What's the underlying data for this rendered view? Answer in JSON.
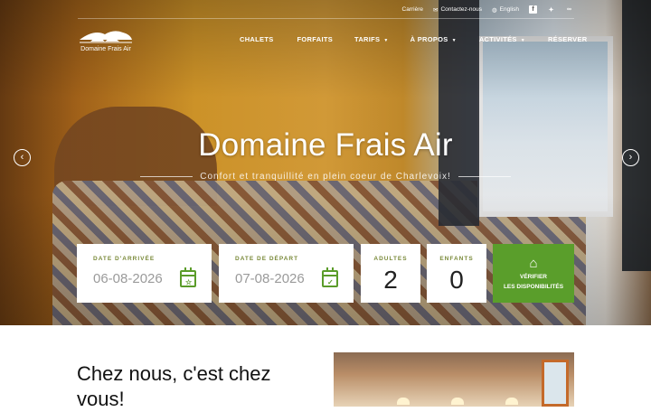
{
  "topbar": {
    "careers": "Carrière",
    "contact": "Contactez-nous",
    "language": "English"
  },
  "logo": {
    "text": "Domaine Frais Air"
  },
  "nav": [
    {
      "label": "CHALETS"
    },
    {
      "label": "FORFAITS"
    },
    {
      "label": "TARIFS"
    },
    {
      "label": "À PROPOS"
    },
    {
      "label": "ACTIVITÉS"
    },
    {
      "label": "RÉSERVER"
    }
  ],
  "hero": {
    "title": "Domaine Frais Air",
    "subtitle": "Confort et tranquillité en plein coeur de Charlevoix!"
  },
  "booking": {
    "arrival_label": "DATE D'ARRIVÉE",
    "arrival_value": "06-08-2026",
    "departure_label": "DATE DE DÉPART",
    "departure_value": "07-08-2026",
    "adults_label": "ADULTES",
    "adults_value": "2",
    "children_label": "ENFANTS",
    "children_value": "0",
    "cta_line1": "VÉRIFIER",
    "cta_line2": "LES DISPONIBILITÉS"
  },
  "intro": {
    "heading": "Chez nous, c'est chez vous!"
  },
  "colors": {
    "accent": "#5a9e2b",
    "label": "#7a8a3a"
  },
  "icons": [
    "envelope-icon",
    "globe-icon",
    "facebook-icon",
    "twitter-icon",
    "tripadvisor-icon",
    "arrow-left-icon",
    "arrow-right-icon",
    "calendar-star-icon",
    "calendar-check-icon",
    "house-search-icon"
  ]
}
